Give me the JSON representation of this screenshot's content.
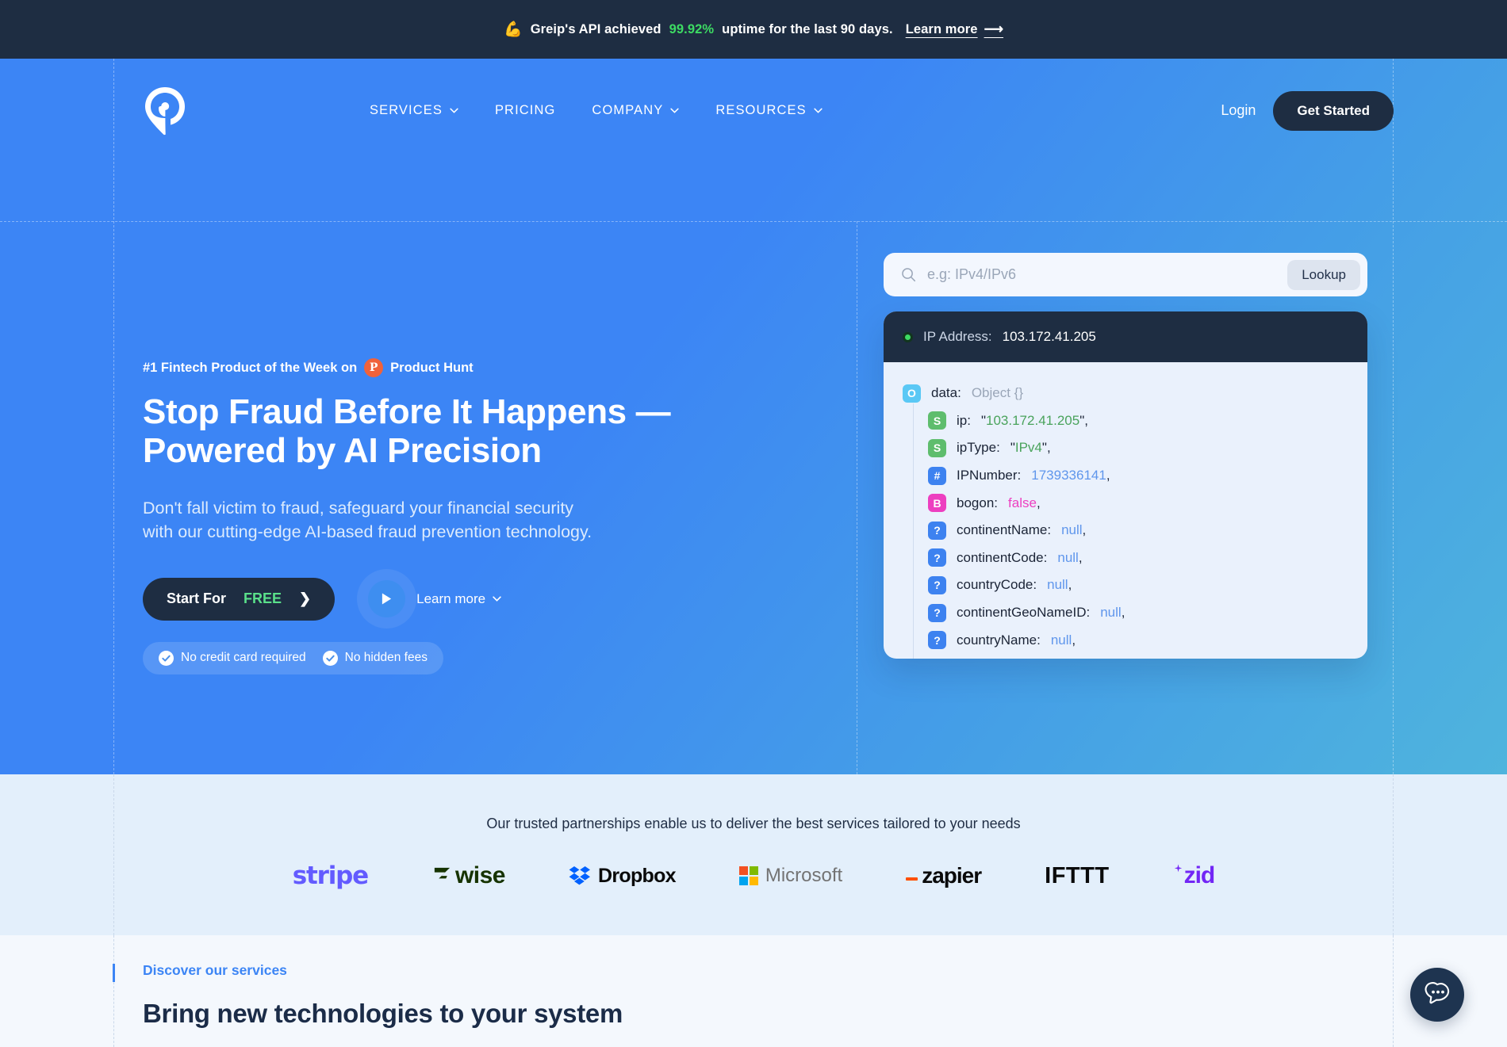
{
  "announcement": {
    "emoji": "💪",
    "text_before": "Greip's API achieved",
    "percent": "99.92%",
    "text_after": "uptime for the last 90 days.",
    "learn_more": "Learn more",
    "arrow": "⟶",
    "bg_color": "#1e2d42",
    "accent_color": "#3ddb63"
  },
  "nav": {
    "logo_name": "greip-logo",
    "links": [
      {
        "label": "SERVICES",
        "has_dropdown": true
      },
      {
        "label": "PRICING",
        "has_dropdown": false
      },
      {
        "label": "COMPANY",
        "has_dropdown": true
      },
      {
        "label": "RESOURCES",
        "has_dropdown": true
      }
    ],
    "login": "Login",
    "get_started": "Get Started"
  },
  "hero": {
    "eyebrow_text": "#1 Fintech Product of the Week on",
    "product_hunt_badge": "P",
    "product_hunt_label": "Product Hunt",
    "headline_line1": "Stop Fraud Before It Happens —",
    "headline_line2": "Powered by AI Precision",
    "subtitle_line1": "Don't fall victim to fraud, safeguard your financial security",
    "subtitle_line2": "with our cutting-edge AI-based fraud prevention technology.",
    "cta_primary_prefix": "Start For",
    "cta_primary_highlight": "FREE",
    "cta_primary_arrow": "❯",
    "learn_more": "Learn more",
    "pill_1": "No credit card required",
    "pill_2": "No hidden fees",
    "bg_gradient_from": "#3c85f5",
    "bg_gradient_to": "#4fb4dd"
  },
  "lookup": {
    "placeholder": "e.g: IPv4/IPv6",
    "value": "",
    "button_label": "Lookup",
    "result_header_label": "IP Address:",
    "result_header_value": "103.172.41.205",
    "root": {
      "key": "data",
      "meta": "Object {}",
      "type": "object",
      "badge": "O"
    },
    "rows": [
      {
        "badge": "S",
        "type": "string",
        "key": "ip",
        "value": "103.172.41.205",
        "quoted": true
      },
      {
        "badge": "S",
        "type": "string",
        "key": "ipType",
        "value": "IPv4",
        "quoted": true
      },
      {
        "badge": "#",
        "type": "number",
        "key": "IPNumber",
        "value": "1739336141",
        "quoted": false
      },
      {
        "badge": "B",
        "type": "boolean",
        "key": "bogon",
        "value": "false",
        "quoted": false
      },
      {
        "badge": "?",
        "type": "null",
        "key": "continentName",
        "value": "null",
        "quoted": false
      },
      {
        "badge": "?",
        "type": "null",
        "key": "continentCode",
        "value": "null",
        "quoted": false
      },
      {
        "badge": "?",
        "type": "null",
        "key": "countryCode",
        "value": "null",
        "quoted": false
      },
      {
        "badge": "?",
        "type": "null",
        "key": "continentGeoNameID",
        "value": "null",
        "quoted": false
      },
      {
        "badge": "?",
        "type": "null",
        "key": "countryName",
        "value": "null",
        "quoted": false
      }
    ]
  },
  "partners": {
    "caption": "Our trusted partnerships enable us to deliver the best services tailored to your needs",
    "logos": [
      {
        "name": "stripe",
        "label": "stripe",
        "color": "#635bff"
      },
      {
        "name": "wise",
        "label": "wise",
        "color": "#163300"
      },
      {
        "name": "dropbox",
        "label": "Dropbox",
        "color": "#0a0a0a"
      },
      {
        "name": "microsoft",
        "label": "Microsoft",
        "color": "#737373"
      },
      {
        "name": "zapier",
        "label": "zapier",
        "color": "#0a0a0a"
      },
      {
        "name": "ifttt",
        "label": "IFTTT",
        "color": "#0a0a0a"
      },
      {
        "name": "zid",
        "label": "zid",
        "color": "#7226f5"
      }
    ]
  },
  "services": {
    "eyebrow": "Discover our services",
    "title": "Bring new technologies to your system"
  },
  "chat": {
    "name": "chat-widget-button"
  }
}
